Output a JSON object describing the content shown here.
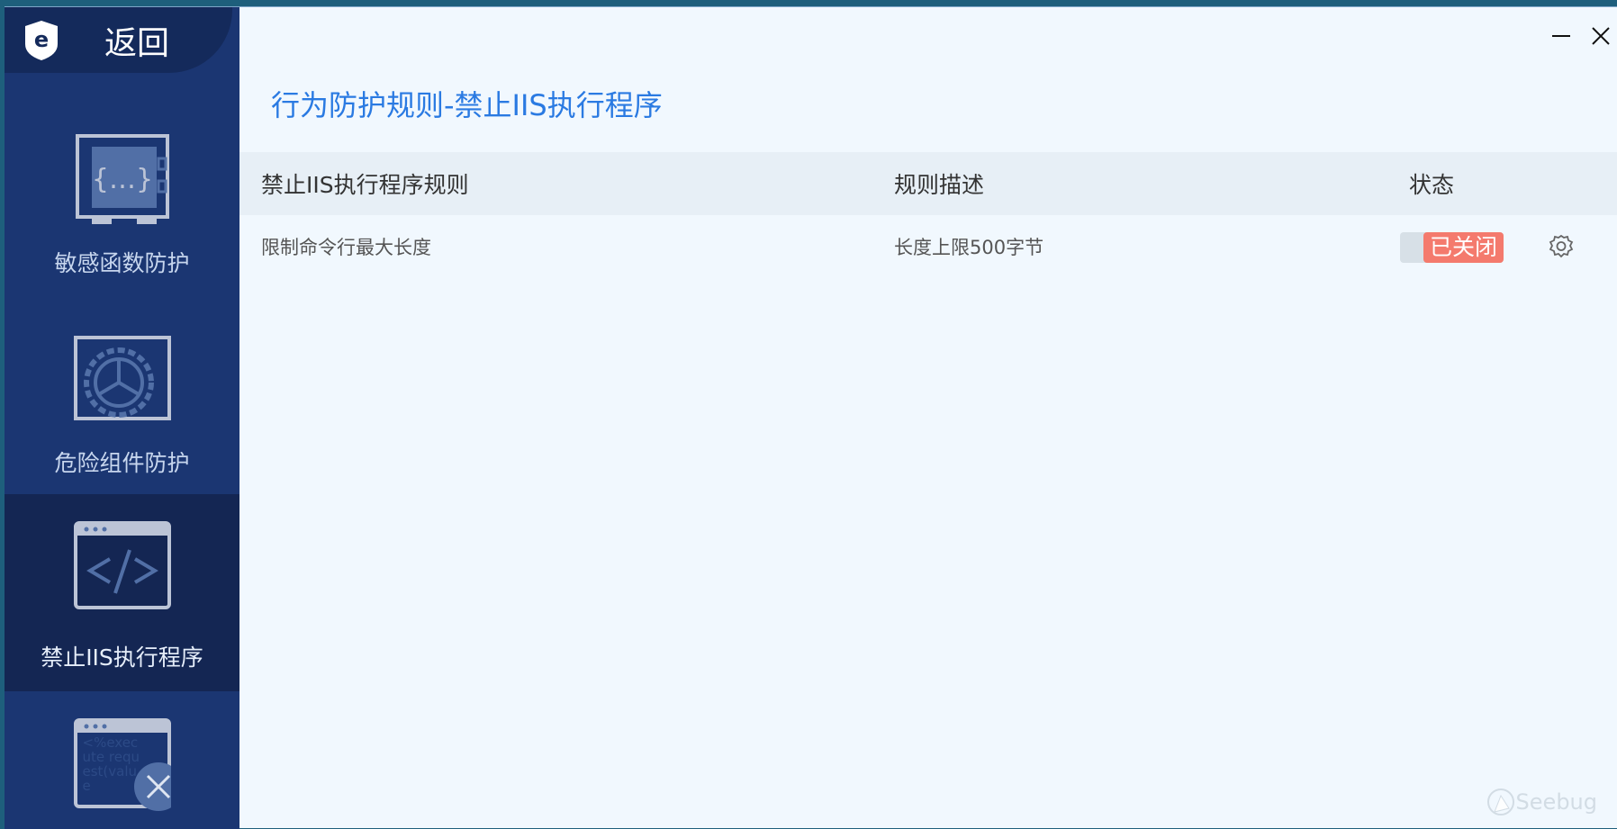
{
  "sidebar": {
    "back_label": "返回",
    "items": [
      {
        "label": "敏感函数防护",
        "icon": "safe-braces-icon"
      },
      {
        "label": "危险组件防护",
        "icon": "gear-window-icon"
      },
      {
        "label": "禁止IIS执行程序",
        "icon": "code-window-icon",
        "active": true
      },
      {
        "label": "",
        "icon": "execute-request-blocked-icon",
        "icon_text": "<%execute request(value"
      }
    ]
  },
  "page": {
    "title": "行为防护规则-禁止IIS执行程序"
  },
  "table": {
    "headers": [
      "禁止IIS执行程序规则",
      "规则描述",
      "状态"
    ],
    "rows": [
      {
        "rule": "限制命令行最大长度",
        "desc": "长度上限500字节",
        "status": "已关闭"
      }
    ]
  },
  "colors": {
    "accent": "#2a7ae2",
    "status_off": "#f47a6d",
    "sidebar": "#1b3672"
  },
  "watermark": "Seebug"
}
